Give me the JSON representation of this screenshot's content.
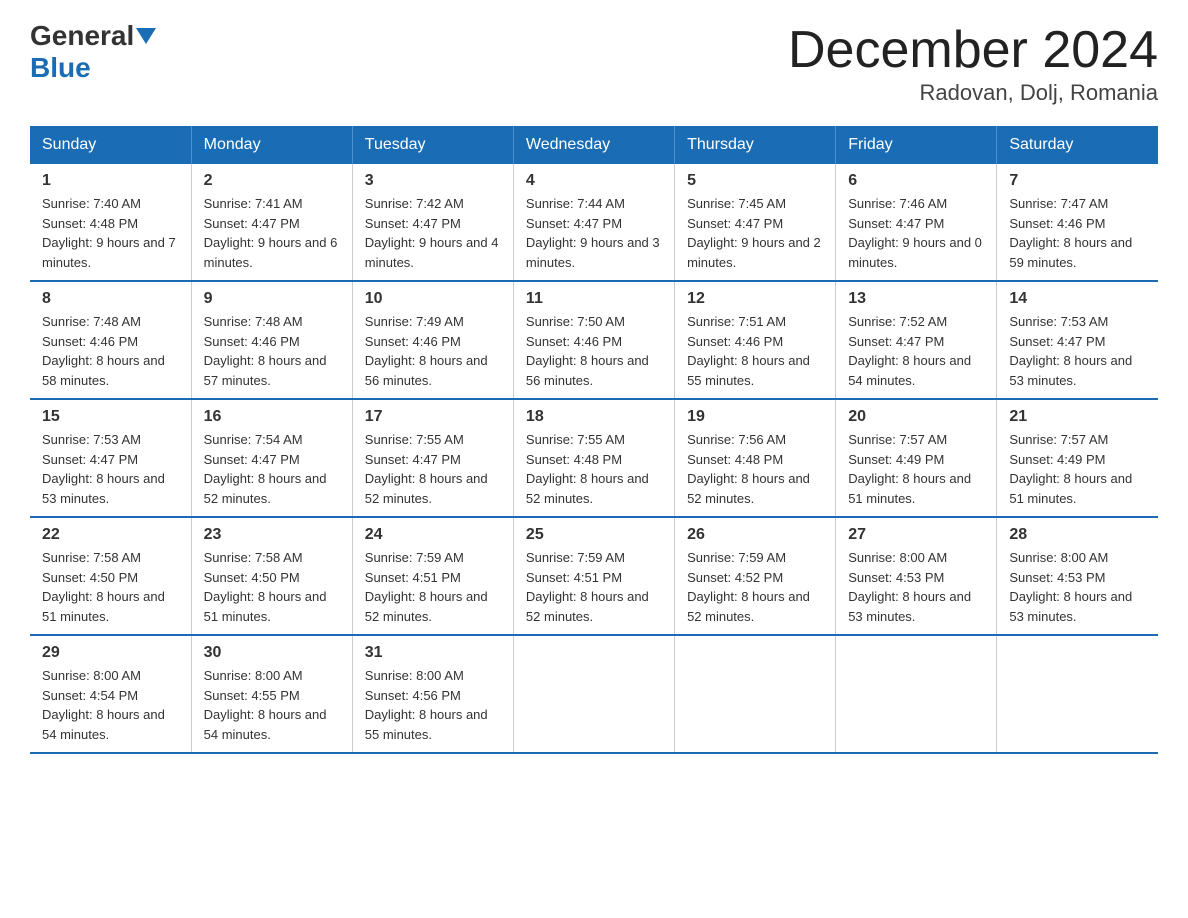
{
  "header": {
    "logo_general": "General",
    "logo_blue": "Blue",
    "month_title": "December 2024",
    "location": "Radovan, Dolj, Romania"
  },
  "days_of_week": [
    "Sunday",
    "Monday",
    "Tuesday",
    "Wednesday",
    "Thursday",
    "Friday",
    "Saturday"
  ],
  "weeks": [
    [
      {
        "num": "1",
        "sunrise": "7:40 AM",
        "sunset": "4:48 PM",
        "daylight": "9 hours and 7 minutes."
      },
      {
        "num": "2",
        "sunrise": "7:41 AM",
        "sunset": "4:47 PM",
        "daylight": "9 hours and 6 minutes."
      },
      {
        "num": "3",
        "sunrise": "7:42 AM",
        "sunset": "4:47 PM",
        "daylight": "9 hours and 4 minutes."
      },
      {
        "num": "4",
        "sunrise": "7:44 AM",
        "sunset": "4:47 PM",
        "daylight": "9 hours and 3 minutes."
      },
      {
        "num": "5",
        "sunrise": "7:45 AM",
        "sunset": "4:47 PM",
        "daylight": "9 hours and 2 minutes."
      },
      {
        "num": "6",
        "sunrise": "7:46 AM",
        "sunset": "4:47 PM",
        "daylight": "9 hours and 0 minutes."
      },
      {
        "num": "7",
        "sunrise": "7:47 AM",
        "sunset": "4:46 PM",
        "daylight": "8 hours and 59 minutes."
      }
    ],
    [
      {
        "num": "8",
        "sunrise": "7:48 AM",
        "sunset": "4:46 PM",
        "daylight": "8 hours and 58 minutes."
      },
      {
        "num": "9",
        "sunrise": "7:48 AM",
        "sunset": "4:46 PM",
        "daylight": "8 hours and 57 minutes."
      },
      {
        "num": "10",
        "sunrise": "7:49 AM",
        "sunset": "4:46 PM",
        "daylight": "8 hours and 56 minutes."
      },
      {
        "num": "11",
        "sunrise": "7:50 AM",
        "sunset": "4:46 PM",
        "daylight": "8 hours and 56 minutes."
      },
      {
        "num": "12",
        "sunrise": "7:51 AM",
        "sunset": "4:46 PM",
        "daylight": "8 hours and 55 minutes."
      },
      {
        "num": "13",
        "sunrise": "7:52 AM",
        "sunset": "4:47 PM",
        "daylight": "8 hours and 54 minutes."
      },
      {
        "num": "14",
        "sunrise": "7:53 AM",
        "sunset": "4:47 PM",
        "daylight": "8 hours and 53 minutes."
      }
    ],
    [
      {
        "num": "15",
        "sunrise": "7:53 AM",
        "sunset": "4:47 PM",
        "daylight": "8 hours and 53 minutes."
      },
      {
        "num": "16",
        "sunrise": "7:54 AM",
        "sunset": "4:47 PM",
        "daylight": "8 hours and 52 minutes."
      },
      {
        "num": "17",
        "sunrise": "7:55 AM",
        "sunset": "4:47 PM",
        "daylight": "8 hours and 52 minutes."
      },
      {
        "num": "18",
        "sunrise": "7:55 AM",
        "sunset": "4:48 PM",
        "daylight": "8 hours and 52 minutes."
      },
      {
        "num": "19",
        "sunrise": "7:56 AM",
        "sunset": "4:48 PM",
        "daylight": "8 hours and 52 minutes."
      },
      {
        "num": "20",
        "sunrise": "7:57 AM",
        "sunset": "4:49 PM",
        "daylight": "8 hours and 51 minutes."
      },
      {
        "num": "21",
        "sunrise": "7:57 AM",
        "sunset": "4:49 PM",
        "daylight": "8 hours and 51 minutes."
      }
    ],
    [
      {
        "num": "22",
        "sunrise": "7:58 AM",
        "sunset": "4:50 PM",
        "daylight": "8 hours and 51 minutes."
      },
      {
        "num": "23",
        "sunrise": "7:58 AM",
        "sunset": "4:50 PM",
        "daylight": "8 hours and 51 minutes."
      },
      {
        "num": "24",
        "sunrise": "7:59 AM",
        "sunset": "4:51 PM",
        "daylight": "8 hours and 52 minutes."
      },
      {
        "num": "25",
        "sunrise": "7:59 AM",
        "sunset": "4:51 PM",
        "daylight": "8 hours and 52 minutes."
      },
      {
        "num": "26",
        "sunrise": "7:59 AM",
        "sunset": "4:52 PM",
        "daylight": "8 hours and 52 minutes."
      },
      {
        "num": "27",
        "sunrise": "8:00 AM",
        "sunset": "4:53 PM",
        "daylight": "8 hours and 53 minutes."
      },
      {
        "num": "28",
        "sunrise": "8:00 AM",
        "sunset": "4:53 PM",
        "daylight": "8 hours and 53 minutes."
      }
    ],
    [
      {
        "num": "29",
        "sunrise": "8:00 AM",
        "sunset": "4:54 PM",
        "daylight": "8 hours and 54 minutes."
      },
      {
        "num": "30",
        "sunrise": "8:00 AM",
        "sunset": "4:55 PM",
        "daylight": "8 hours and 54 minutes."
      },
      {
        "num": "31",
        "sunrise": "8:00 AM",
        "sunset": "4:56 PM",
        "daylight": "8 hours and 55 minutes."
      },
      {
        "num": "",
        "sunrise": "",
        "sunset": "",
        "daylight": ""
      },
      {
        "num": "",
        "sunrise": "",
        "sunset": "",
        "daylight": ""
      },
      {
        "num": "",
        "sunrise": "",
        "sunset": "",
        "daylight": ""
      },
      {
        "num": "",
        "sunrise": "",
        "sunset": "",
        "daylight": ""
      }
    ]
  ],
  "labels": {
    "sunrise": "Sunrise:",
    "sunset": "Sunset:",
    "daylight": "Daylight:"
  }
}
